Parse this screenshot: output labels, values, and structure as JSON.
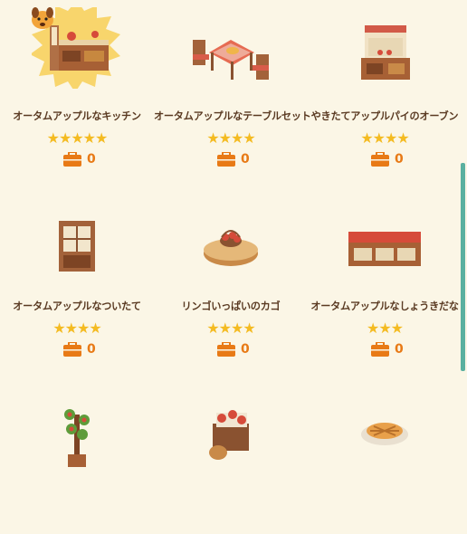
{
  "items": [
    {
      "name": "オータムアップルなキッチン",
      "stars": "★★★★★",
      "count": "0",
      "highlight": true
    },
    {
      "name": "オータムアップルなテーブルセット",
      "stars": "★★★★",
      "count": "0"
    },
    {
      "name": "やきたてアップルパイのオーブン",
      "stars": "★★★★",
      "count": "0"
    },
    {
      "name": "オータムアップルなついたて",
      "stars": "★★★★",
      "count": "0"
    },
    {
      "name": "リンゴいっぱいのカゴ",
      "stars": "★★★★",
      "count": "0"
    },
    {
      "name": "オータムアップルなしょうきだな",
      "stars": "★★★",
      "count": "0"
    },
    {
      "name": "",
      "stars": "",
      "count": ""
    },
    {
      "name": "",
      "stars": "",
      "count": ""
    },
    {
      "name": "",
      "stars": "",
      "count": ""
    }
  ],
  "icons": {
    "bag": "toolbox-icon",
    "star": "star-icon"
  },
  "colors": {
    "background": "#fbf6e6",
    "text": "#5a3a22",
    "star": "#f4bb22",
    "bag": "#e87a16",
    "scrollbar": "#5ab0a0"
  }
}
